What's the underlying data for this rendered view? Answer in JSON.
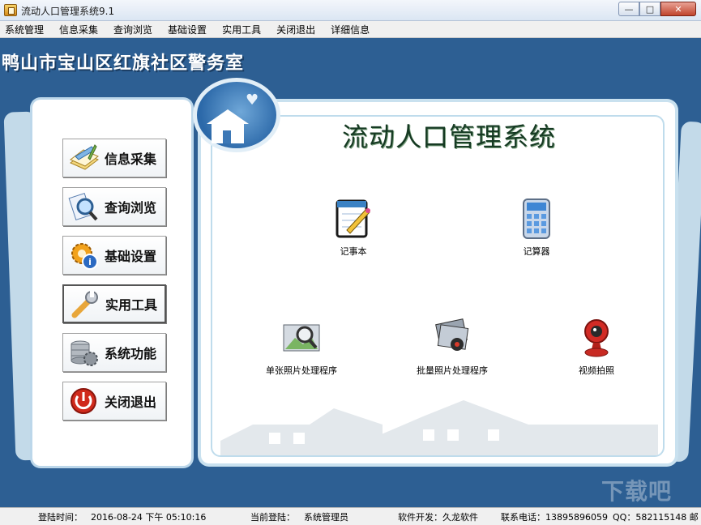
{
  "window": {
    "title": "流动人口管理系统9.1"
  },
  "menu": [
    "系统管理",
    "信息采集",
    "查询浏览",
    "基础设置",
    "实用工具",
    "关闭退出",
    "详细信息"
  ],
  "org_title": "鸭山市宝山区红旗社区警务室",
  "sidebar": {
    "items": [
      {
        "label": "信息采集",
        "icon": "info-collect-icon"
      },
      {
        "label": "查询浏览",
        "icon": "query-browse-icon"
      },
      {
        "label": "基础设置",
        "icon": "gear-info-icon"
      },
      {
        "label": "实用工具",
        "icon": "wrench-icon"
      },
      {
        "label": "系统功能",
        "icon": "database-icon"
      },
      {
        "label": "关闭退出",
        "icon": "power-icon"
      }
    ],
    "selected_index": 3
  },
  "main": {
    "title": "流动人口管理系统",
    "tools": [
      {
        "label": "记事本",
        "icon": "notepad-icon"
      },
      {
        "label": "记算器",
        "icon": "calculator-icon"
      },
      {
        "label": "单张照片处理程序",
        "icon": "photo-magnifier-icon"
      },
      {
        "label": "批量照片处理程序",
        "icon": "photo-batch-icon"
      },
      {
        "label": "视频拍照",
        "icon": "webcam-icon"
      }
    ]
  },
  "status": {
    "login_time_label": "登陆时间：",
    "login_time_value": "2016-08-24  下午  05:10:16",
    "current_user_label": "当前登陆：",
    "current_user_value": "系统管理员",
    "developer": "软件开发：久龙软件",
    "phone": "联系电话：13895896059",
    "qq": "QQ：582115148 邮"
  },
  "colors": {
    "background": "#2d5f93",
    "panel_border": "#bcd7ea"
  }
}
